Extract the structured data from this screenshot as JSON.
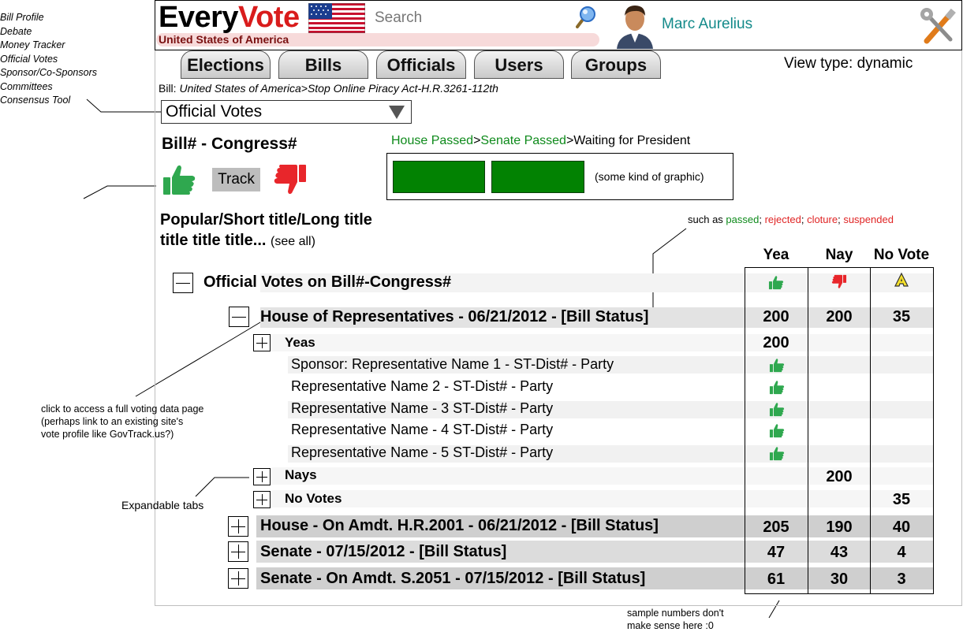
{
  "annotation_menu": [
    "Bill Profile",
    "Debate",
    "Money Tracker",
    "Official Votes",
    "Sponsor/Co-Sponsors",
    "Committees",
    "Consensus Tool"
  ],
  "header": {
    "logo_every": "Every",
    "logo_vote": "Vote",
    "country": "United States of America",
    "search_placeholder": "Search",
    "username": "Marc Aurelius"
  },
  "tabs": [
    "Elections",
    "Bills",
    "Officials",
    "Users",
    "Groups"
  ],
  "view_type": "View type: dynamic",
  "breadcrumb": {
    "label": "Bill: ",
    "path": "United States of America>Stop Online Piracy Act-H.R.3261-112th"
  },
  "dropdown": {
    "selected": "Official Votes"
  },
  "bill_header": "Bill# - Congress#",
  "progress": {
    "house": "House Passed",
    "sep1": ">",
    "senate": "Senate Passed",
    "sep2": ">",
    "waiting": "Waiting for President",
    "graphic_note": "(some kind of graphic)"
  },
  "track_label": "Track",
  "titles": {
    "line1": "Popular/Short title/Long title",
    "line2": "title title title... ",
    "see_all": "(see all)"
  },
  "status_note": {
    "prefix": "such as ",
    "passed": "passed",
    "sep1": "; ",
    "rejected": "rejected",
    "sep2": "; ",
    "cloture": "cloture",
    "sep3": "; ",
    "suspended": "suspended"
  },
  "columns": {
    "yea": "Yea",
    "nay": "Nay",
    "novote": "No Vote"
  },
  "official_votes_title": "Official Votes on Bill#-Congress#",
  "votes": {
    "house_main": {
      "label": "House of Representatives - 06/21/2012 - [Bill Status]",
      "yea": "200",
      "nay": "200",
      "novote": "35"
    },
    "yeas": {
      "label": "Yeas",
      "yea": "200"
    },
    "representatives": [
      "Sponsor: Representative Name 1 - ST-Dist# - Party",
      "Representative Name 2 - ST-Dist# - Party",
      "Representative Name - 3 ST-Dist# - Party",
      "Representative Name - 4 ST-Dist# - Party",
      "Representative Name - 5 ST-Dist# - Party"
    ],
    "nays": {
      "label": "Nays",
      "nay": "200"
    },
    "novotes": {
      "label": "No Votes",
      "novote": "35"
    },
    "amdt1": {
      "label": "House - On Amdt. H.R.2001 - 06/21/2012 - [Bill Status]",
      "yea": "205",
      "nay": "190",
      "novote": "40"
    },
    "senate1": {
      "label": "Senate - 07/15/2012 - [Bill Status]",
      "yea": "47",
      "nay": "43",
      "novote": "4"
    },
    "senate2": {
      "label": "Senate -  On Amdt. S.2051 - 07/15/2012 - [Bill Status]",
      "yea": "61",
      "nay": "30",
      "novote": "3"
    }
  },
  "annotations": {
    "click_access": [
      "click to access a full voting data page",
      "(perhaps link to an existing site's",
      "vote profile like GovTrack.us?)"
    ],
    "expandable": "Expandable tabs",
    "sample_numbers": [
      "sample numbers don't",
      "make sense here :0"
    ]
  },
  "colors": {
    "brand_red": "#d91c1c",
    "status_green": "#0e8a1b",
    "status_red": "#e02424",
    "bar_green": "#028202",
    "username_teal": "#138a8a"
  }
}
